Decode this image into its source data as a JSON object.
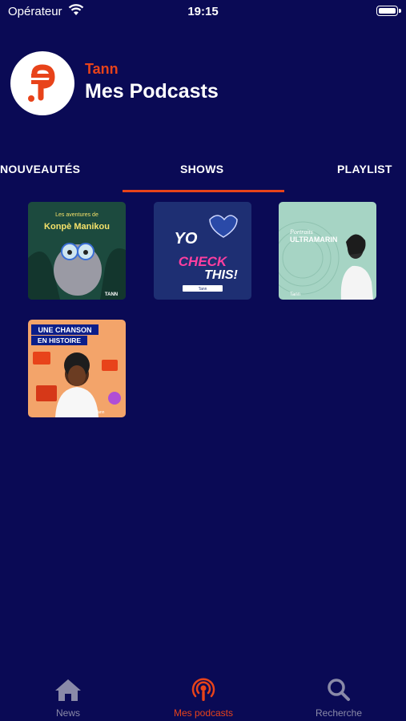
{
  "status_bar": {
    "carrier": "Opérateur",
    "time": "19:15"
  },
  "header": {
    "brand": "Tann",
    "title": "Mes Podcasts"
  },
  "tabs": [
    {
      "label": "NOUVEAUTÉS",
      "active": false
    },
    {
      "label": "SHOWS",
      "active": true
    },
    {
      "label": "PLAYLIST",
      "active": false
    }
  ],
  "shows": [
    {
      "title_top": "Les aventures de",
      "title_main": "Konpè Manikou",
      "brand": "TANN"
    },
    {
      "title_main": "YO CHECK THIS!",
      "brand": "Tann"
    },
    {
      "title_top": "Portraits",
      "title_main": "ULTRAMARIN",
      "brand": "Tann"
    },
    {
      "title_top": "UNE CHANSON",
      "title_main": "EN HISTOIRE",
      "brand": "Tann"
    }
  ],
  "bottom_nav": [
    {
      "label": "News",
      "icon": "home-icon",
      "active": false
    },
    {
      "label": "Mes podcasts",
      "icon": "podcast-icon",
      "active": true
    },
    {
      "label": "Recherche",
      "icon": "search-icon",
      "active": false
    }
  ],
  "colors": {
    "background": "#0a0a55",
    "accent": "#e8431a",
    "inactive": "#8a8aa8"
  }
}
